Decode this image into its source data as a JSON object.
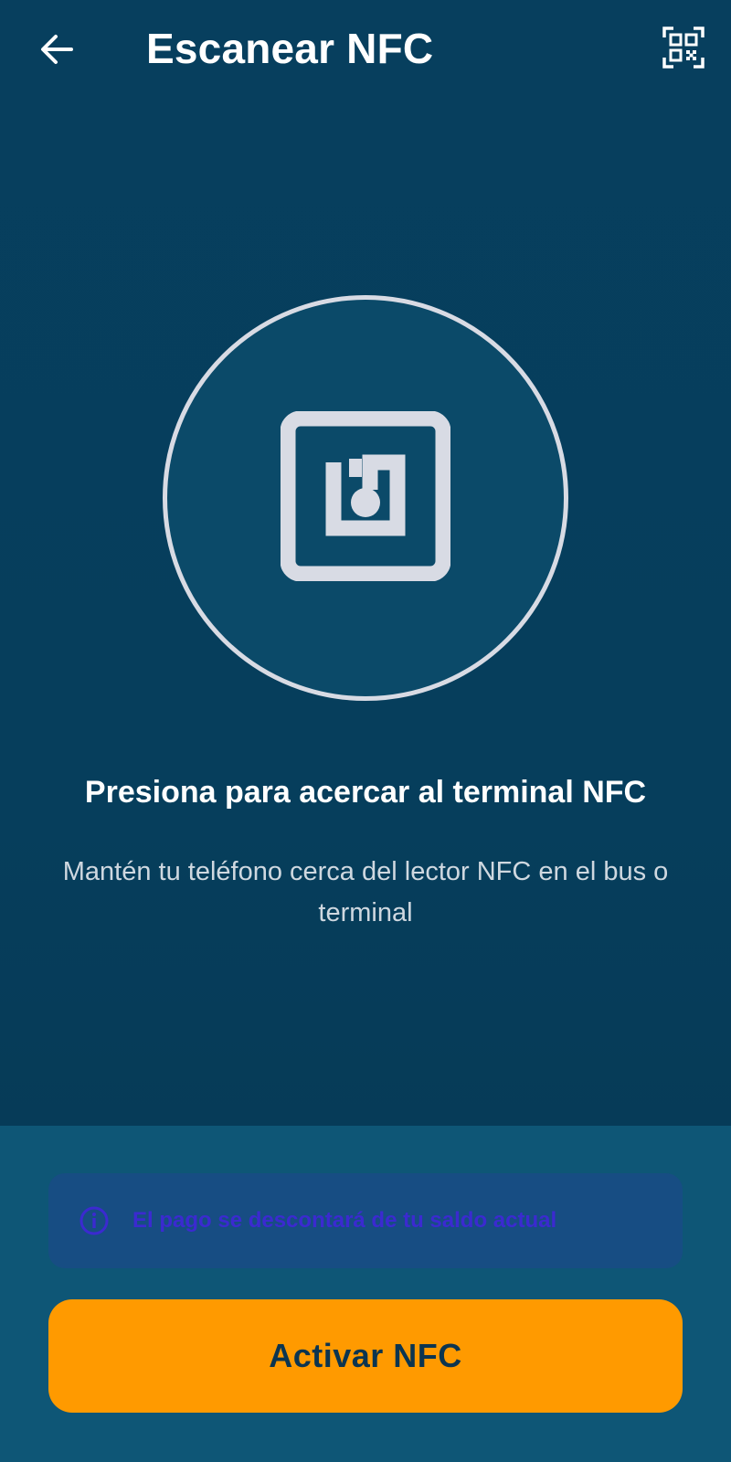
{
  "header": {
    "title": "Escanear NFC",
    "back_icon": "arrow-left-icon",
    "qr_icon": "qr-code-scan-icon"
  },
  "nfc": {
    "icon": "nfc-icon"
  },
  "instructions": {
    "title": "Presiona para acercar al terminal NFC",
    "subtitle": "Mantén tu teléfono cerca del lector NFC en el bus o terminal"
  },
  "info": {
    "icon": "info-icon",
    "text": "El pago se descontará de tu saldo actual"
  },
  "actions": {
    "activate_label": "Activar NFC"
  },
  "colors": {
    "background": "#073f5e",
    "circle_fill": "#0b4a69",
    "circle_stroke": "#d8dbe4",
    "panel": "#0e5676",
    "info_box": "#174d83",
    "info_text": "#3b2ad0",
    "button": "#ff9a00",
    "button_text": "#0c3550"
  }
}
